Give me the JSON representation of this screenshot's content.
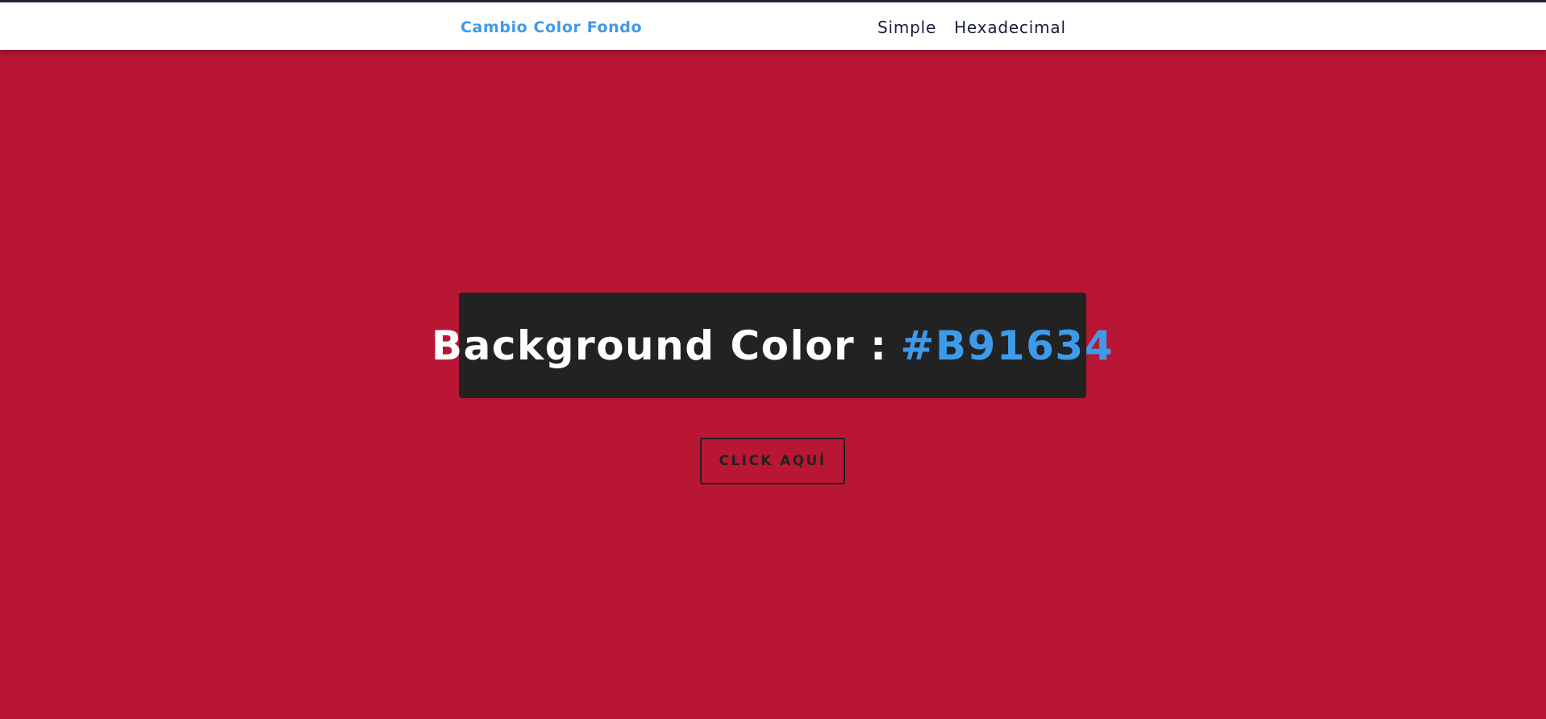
{
  "navbar": {
    "brand": "Cambio Color Fondo",
    "links": [
      {
        "label": "Simple"
      },
      {
        "label": "Hexadecimal"
      }
    ]
  },
  "main": {
    "color_label": "Background Color :",
    "color_value": "#B91634",
    "button_label": "CLICK AQUÍ"
  },
  "colors": {
    "background": "#B91634",
    "accent": "#3d9be9",
    "box": "#222222",
    "nav_text": "#18203a"
  }
}
